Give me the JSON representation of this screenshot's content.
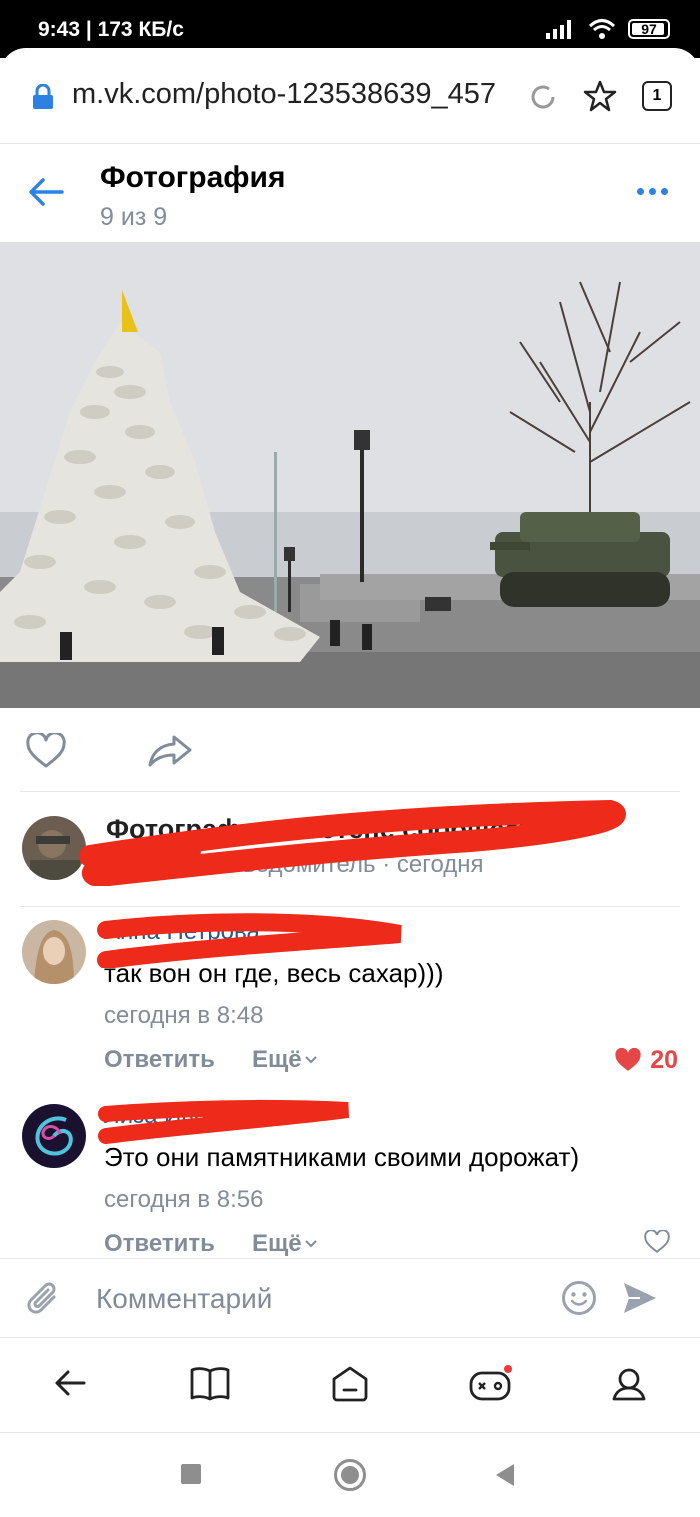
{
  "status_bar": {
    "time_speed": "9:43 | 173 КБ/с",
    "battery": "97"
  },
  "browser": {
    "url": "m.vk.com/photo-123538639_457",
    "tab_count": "1"
  },
  "header": {
    "title": "Фотография",
    "subtitle": "9 из 9"
  },
  "photo": {
    "colors": {
      "sky": "#dfe0e3",
      "sandbags": "#e4e2dc",
      "ground": "#7d7d7d",
      "tank": "#4a5240"
    }
  },
  "source": {
    "line1": "Фотографии на стене сообщества",
    "group": "Военный Осведомитель",
    "time": "· сегодня"
  },
  "comments": [
    {
      "author": "Анна Петрова",
      "text": "так вон он где, весь сахар)))",
      "time": "сегодня в 8:48",
      "reply": "Ответить",
      "more": "Ещё",
      "likes": "20",
      "liked": true
    },
    {
      "author": "Лиза Иванова",
      "text": "Это они памятниками своими дорожат)",
      "time": "сегодня в 8:56",
      "reply": "Ответить",
      "more": "Ещё",
      "likes": "",
      "liked": false
    }
  ],
  "comment_input": {
    "placeholder": "Комментарий"
  },
  "icons": [
    "lock-icon",
    "reload-icon",
    "star-icon",
    "back-arrow-icon",
    "more-dots-icon",
    "heart-icon",
    "share-icon",
    "paperclip-icon",
    "smile-icon",
    "send-icon",
    "book-icon",
    "home-icon",
    "games-icon",
    "profile-icon"
  ],
  "colors": {
    "accent": "#2d81e0",
    "link": "#2a5885",
    "secondary": "#818c99",
    "like": "#e64646",
    "redaction": "#ee2a1a"
  }
}
